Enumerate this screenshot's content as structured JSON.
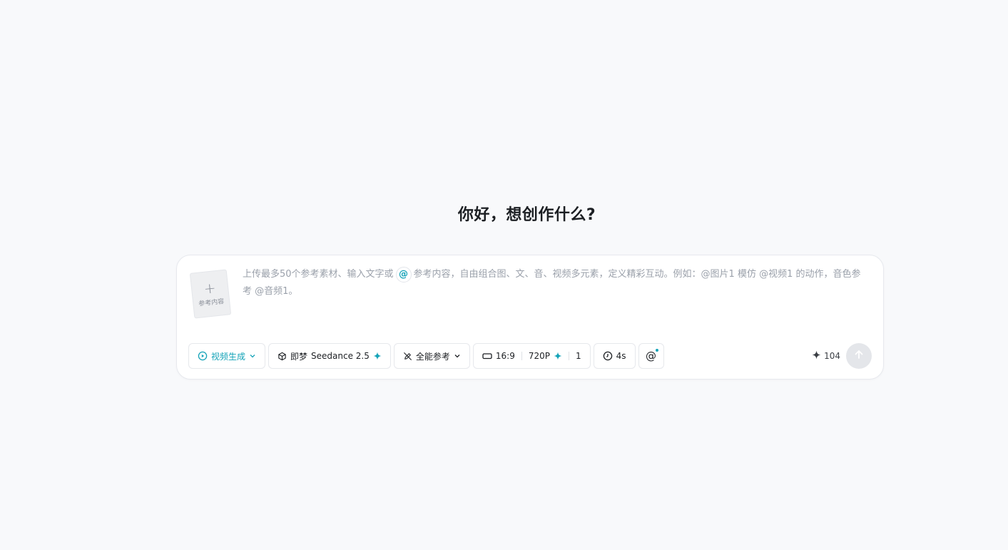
{
  "greeting": "你好，想创作什么?",
  "reference_card": {
    "plus": "+",
    "label": "参考内容"
  },
  "prompt": {
    "before_at": "上传最多50个参考素材、输入文字或",
    "at_symbol": "@",
    "after_at": "参考内容，自由组合图、文、音、视频多元素，定义精彩互动。例如：@图片1 模仿 @视频1 的动作，音色参考 @音频1。"
  },
  "toolbar": {
    "mode": "视频生成",
    "model_prefix": "即梦",
    "model_name": "Seedance 2.5",
    "reference_mode": "全能参考",
    "aspect_ratio": "16:9",
    "resolution": "720P",
    "count": "1",
    "duration": "4s",
    "mention": "@"
  },
  "credits": "104",
  "colors": {
    "accent": "#14a3b8",
    "background": "#f8f9fb",
    "placeholder": "#9aa0aa"
  },
  "icons": [
    "video-mode-icon",
    "chevron-down-icon",
    "cube-icon",
    "sparkle-icon",
    "pencil-slash-icon",
    "aspect-ratio-icon",
    "clock-icon",
    "at-icon",
    "send-arrow-icon"
  ]
}
